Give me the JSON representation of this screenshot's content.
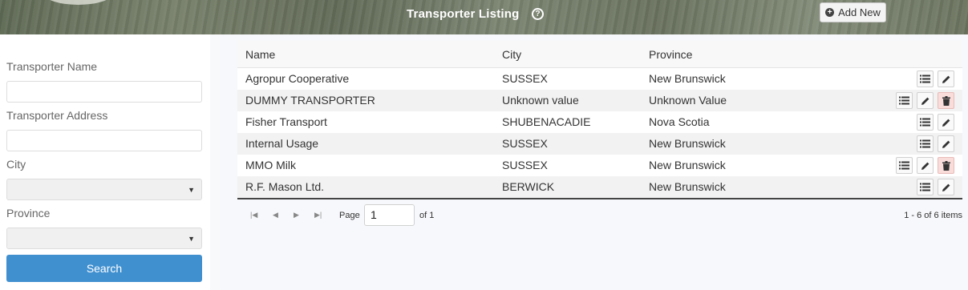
{
  "header": {
    "title": "Transporter Listing",
    "add_new_label": "Add New"
  },
  "filters": {
    "name_label": "Transporter Name",
    "name_value": "",
    "address_label": "Transporter Address",
    "address_value": "",
    "city_label": "City",
    "city_value": "",
    "province_label": "Province",
    "province_value": "",
    "search_label": "Search"
  },
  "table": {
    "columns": [
      "Name",
      "City",
      "Province"
    ],
    "rows": [
      {
        "name": "Agropur Cooperative",
        "city": "SUSSEX",
        "province": "New Brunswick",
        "deletable": false
      },
      {
        "name": "DUMMY TRANSPORTER",
        "city": "Unknown value",
        "province": "Unknown Value",
        "deletable": true
      },
      {
        "name": "Fisher Transport",
        "city": "SHUBENACADIE",
        "province": "Nova Scotia",
        "deletable": false
      },
      {
        "name": "Internal Usage",
        "city": "SUSSEX",
        "province": "New Brunswick",
        "deletable": false
      },
      {
        "name": "MMO Milk",
        "city": "SUSSEX",
        "province": "New Brunswick",
        "deletable": true
      },
      {
        "name": "R.F. Mason Ltd.",
        "city": "BERWICK",
        "province": "New Brunswick",
        "deletable": false
      }
    ]
  },
  "pager": {
    "page_label": "Page",
    "page_value": "1",
    "of_label": "of 1",
    "items_info": "1 - 6 of 6 items"
  },
  "colors": {
    "primary": "#4090d0",
    "danger_bg": "#f9dddb"
  }
}
